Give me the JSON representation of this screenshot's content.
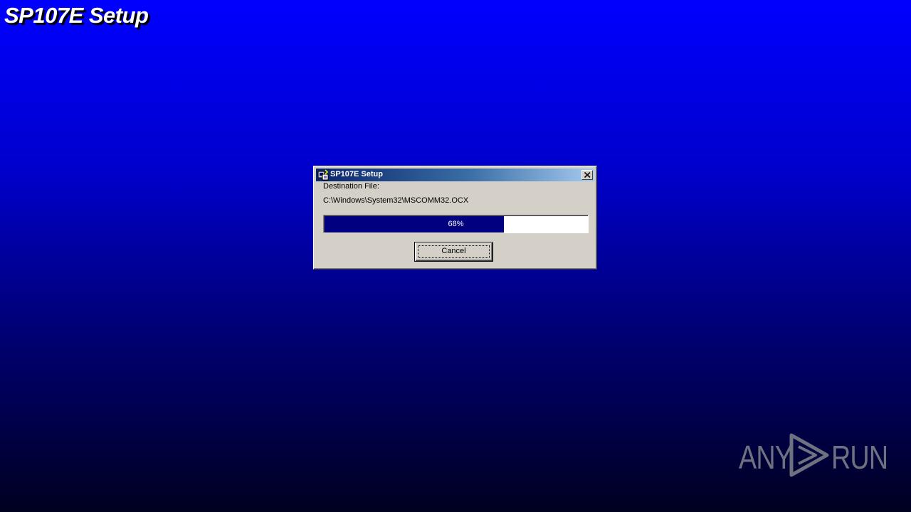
{
  "background": {
    "title": "SP107E Setup",
    "gradient_colors": [
      "#0000ff",
      "#000080",
      "#000020"
    ]
  },
  "dialog": {
    "title": "SP107E Setup",
    "icon": "setup-app-icon",
    "close_icon": "close-icon",
    "destination_label": "Destination File:",
    "destination_path": "C:\\Windows\\System32\\MSCOMM32.OCX",
    "progress_value": 68,
    "progress_text": "68%",
    "cancel_label": "Cancel",
    "colors": {
      "face": "#d4d0c8",
      "titlebar_start": "#0a246a",
      "titlebar_end": "#a6caf0",
      "progress_fill": "#000080"
    }
  },
  "watermark": {
    "left_text": "ANY",
    "right_text": "RUN",
    "icon": "play-icon"
  }
}
